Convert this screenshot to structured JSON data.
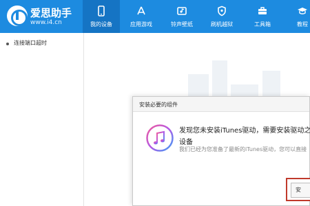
{
  "app": {
    "logo_name": "爱思助手",
    "logo_url": "www.i4.cn"
  },
  "nav": [
    {
      "label": "我的设备",
      "icon": "phone-icon",
      "active": true
    },
    {
      "label": "应用游戏",
      "icon": "app-store-icon",
      "active": false
    },
    {
      "label": "铃声壁纸",
      "icon": "ringtone-wallpaper-icon",
      "active": false
    },
    {
      "label": "刷机越狱",
      "icon": "shield-icon",
      "active": false
    },
    {
      "label": "工具箱",
      "icon": "toolbox-icon",
      "active": false
    },
    {
      "label": "教程",
      "icon": "tutorial-icon",
      "active": false
    }
  ],
  "sidebar": {
    "items": [
      {
        "label": "连接端口超时"
      }
    ]
  },
  "dialog": {
    "title": "安装必要的组件",
    "heading": "发现您未安装iTunes驱动，需要安装驱动之后",
    "heading_line2": "设备",
    "desc": "我们已经为您准备了最新的iTunes驱动，您可以直接",
    "install_label": "安"
  },
  "colors": {
    "brand": "#1d8be0",
    "nav_active": "#1574c4",
    "highlight": "#c0392b"
  }
}
